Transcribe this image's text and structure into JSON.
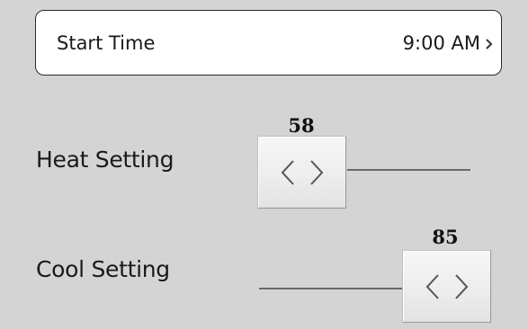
{
  "start_time": {
    "label": "Start Time",
    "value": "9:00 AM",
    "chevron_icon": "chevron-right-icon"
  },
  "heat": {
    "label": "Heat Setting",
    "value": "58",
    "thumb_icon": "left-right-arrows-icon"
  },
  "cool": {
    "label": "Cool Setting",
    "value": "85",
    "thumb_icon": "left-right-arrows-icon"
  },
  "colors": {
    "background": "#d4d4d4",
    "panel": "#ffffff",
    "border": "#2a2a2a"
  }
}
